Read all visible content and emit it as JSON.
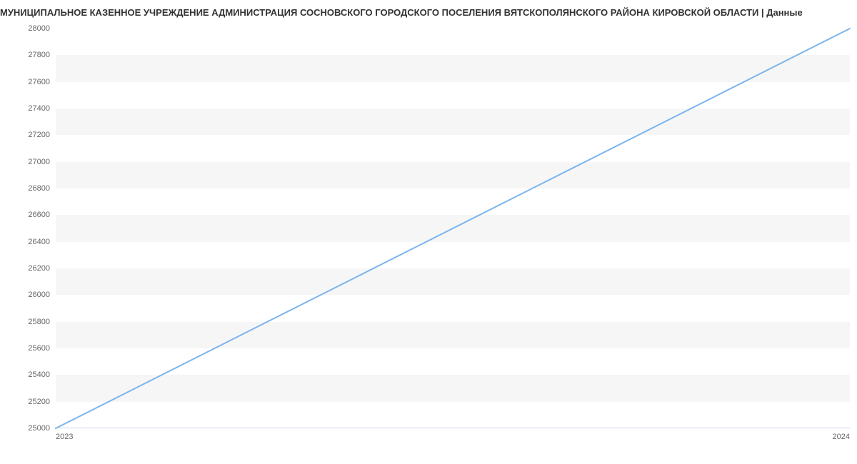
{
  "chart_data": {
    "type": "line",
    "title": "МУНИЦИПАЛЬНОЕ КАЗЕННОЕ УЧРЕЖДЕНИЕ АДМИНИСТРАЦИЯ СОСНОВСКОГО ГОРОДСКОГО ПОСЕЛЕНИЯ ВЯТСКОПОЛЯНСКОГО РАЙОНА КИРОВСКОЙ ОБЛАСТИ | Данные",
    "xlabel": "",
    "ylabel": "",
    "x": [
      "2023",
      "2024"
    ],
    "series": [
      {
        "name": "Данные",
        "values": [
          25000,
          28000
        ]
      }
    ],
    "y_ticks": [
      25000,
      25200,
      25400,
      25600,
      25800,
      26000,
      26200,
      26400,
      26600,
      26800,
      27000,
      27200,
      27400,
      27600,
      27800,
      28000
    ],
    "ylim": [
      25000,
      28000
    ],
    "grid": true,
    "line_color": "#7cb5ec"
  }
}
